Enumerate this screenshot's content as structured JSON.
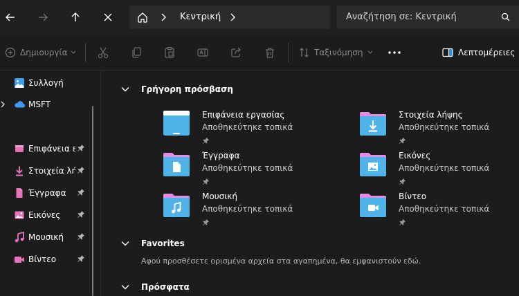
{
  "nav": {
    "breadcrumb": "Κεντρική",
    "search_placeholder": "Αναζήτηση σε: Κεντρική"
  },
  "toolbar": {
    "new_label": "Δημιουργία",
    "sort_label": "Ταξινόμηση",
    "details_label": "Λεπτομέρειες"
  },
  "sidebar": {
    "items": [
      {
        "label": "Συλλογή",
        "icon": "gallery-icon"
      },
      {
        "label": "MSFT",
        "icon": "onedrive-cloud-icon"
      },
      {
        "label": "Επιφάνεια ερ",
        "icon": "desktop-icon"
      },
      {
        "label": "Στοιχεία λήψ",
        "icon": "downloads-icon"
      },
      {
        "label": "Έγγραφα",
        "icon": "documents-icon"
      },
      {
        "label": "Εικόνες",
        "icon": "pictures-icon"
      },
      {
        "label": "Μουσική",
        "icon": "music-icon"
      },
      {
        "label": "Βίντεο",
        "icon": "videos-icon"
      }
    ]
  },
  "main": {
    "quick_access": {
      "title": "Γρήγορη πρόσβαση",
      "items": [
        {
          "name": "Επιφάνεια εργασίας",
          "status": "Αποθηκεύτηκε τοπικά",
          "icon": "desktop-folder-icon"
        },
        {
          "name": "Στοιχεία λήψης",
          "status": "Αποθηκεύτηκε τοπικά",
          "icon": "downloads-folder-icon"
        },
        {
          "name": "Έγγραφα",
          "status": "Αποθηκεύτηκε τοπικά",
          "icon": "documents-folder-icon"
        },
        {
          "name": "Εικόνες",
          "status": "Αποθηκεύτηκε τοπικά",
          "icon": "pictures-folder-icon"
        },
        {
          "name": "Μουσική",
          "status": "Αποθηκεύτηκε τοπικά",
          "icon": "music-folder-icon"
        },
        {
          "name": "Βίντεο",
          "status": "Αποθηκεύτηκε τοπικά",
          "icon": "videos-folder-icon"
        }
      ]
    },
    "favorites": {
      "title": "Favorites",
      "empty_message": "Αφού προσθέσετε ορισμένα αρχεία στα αγαπημένα, θα εμφανιστούν εδώ."
    },
    "recent": {
      "title": "Πρόσφατα"
    }
  },
  "colors": {
    "background": "#1c1c1c",
    "bar": "#202020",
    "field": "#2b2b2b",
    "folder_blue": "#4fb3e8",
    "folder_pink": "#e58be0",
    "accent_blue": "#3b9cf0"
  }
}
